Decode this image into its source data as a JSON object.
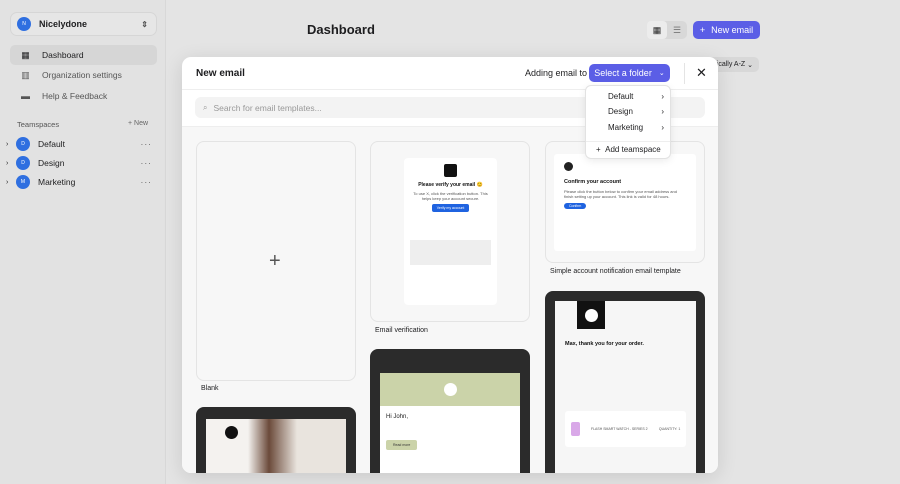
{
  "org": {
    "name": "Nicelydone",
    "initial": "N"
  },
  "nav": [
    {
      "label": "Dashboard",
      "icon": "grid-icon"
    },
    {
      "label": "Organization settings",
      "icon": "building-icon"
    },
    {
      "label": "Help & Feedback",
      "icon": "chat-icon"
    }
  ],
  "teamspaces": {
    "heading": "Teamspaces",
    "new_label": "New",
    "items": [
      {
        "label": "Default",
        "initial": "D"
      },
      {
        "label": "Design",
        "initial": "D"
      },
      {
        "label": "Marketing",
        "initial": "M"
      }
    ]
  },
  "page": {
    "title": "Dashboard",
    "new_email": "New email",
    "sort": "ically A-Z"
  },
  "modal": {
    "title": "New email",
    "adding_label": "Adding email to",
    "folder_button": "Select a folder",
    "search_placeholder": "Search for email templates..."
  },
  "dropdown": {
    "items": [
      "Default",
      "Design",
      "Marketing"
    ],
    "add": "Add teamspace"
  },
  "templates": {
    "blank": "Blank",
    "verify": {
      "label": "Email verification",
      "heading": "Please verify your email 😊",
      "body": "To use X, click the verification button. This helps keep your account secure.",
      "button": "Verify my account"
    },
    "confirm": {
      "label": "Simple account notification email template",
      "heading": "Confirm your account",
      "body": "Please click the button below to confirm your email address and finish setting up your account. This link is valid for 48 hours.",
      "button": "Confirm"
    },
    "order": {
      "heading": "Max, thank you for your order.",
      "product": "FLASH SMART WATCH - SERIES 2",
      "qty": "QUANTITY: 1"
    },
    "john": {
      "greeting": "Hi John,",
      "button": "Read more"
    }
  },
  "colors": {
    "accent": "#5b5ee6",
    "avatar": "#2f6fe0"
  }
}
